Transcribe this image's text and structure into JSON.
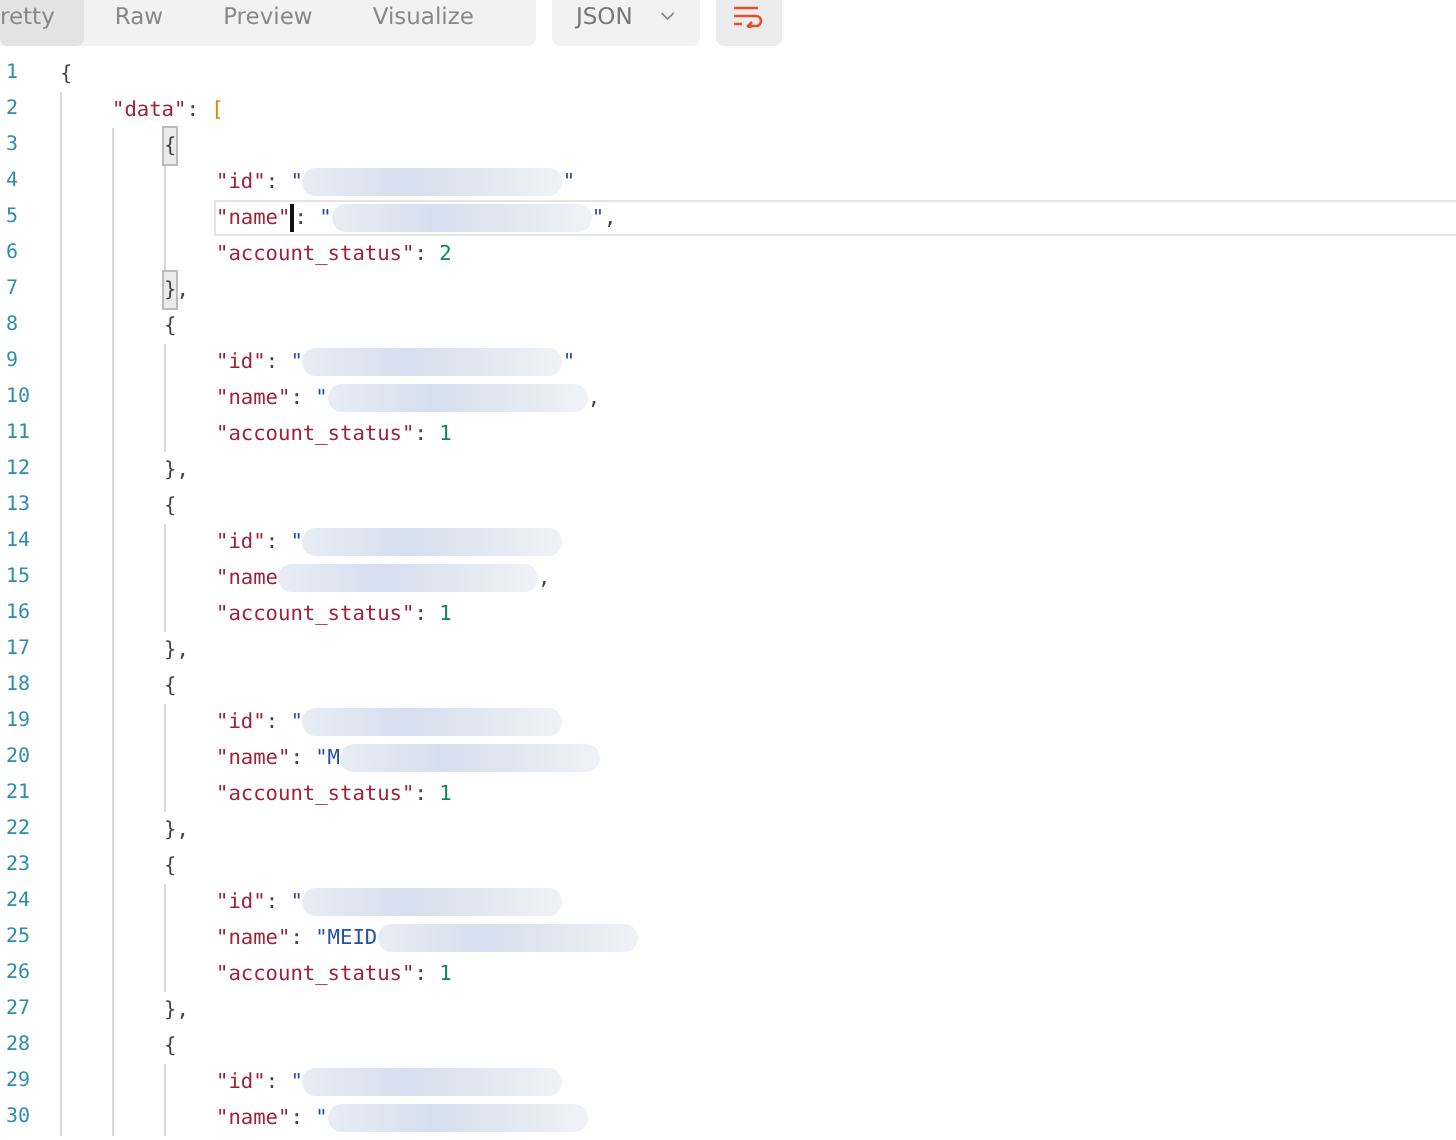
{
  "view_tabs": [
    {
      "label": "retty",
      "selected": true
    },
    {
      "label": "Raw",
      "selected": false
    },
    {
      "label": "Preview",
      "selected": false
    },
    {
      "label": "Visualize",
      "selected": false
    }
  ],
  "format_dropdown": {
    "value": "JSON"
  },
  "wrap_button": {
    "on": true
  },
  "code_lines": [
    {
      "number": "1",
      "selected": false,
      "bracket_match": false,
      "tokens": [
        {
          "kind": "punct",
          "text": "{"
        }
      ],
      "children": [
        {
          "number": "2",
          "selected": false,
          "bracket_match": false,
          "tokens": [
            {
              "kind": "key",
              "text": "\"data\""
            },
            {
              "kind": "punct",
              "text": ": "
            },
            {
              "kind": "bracket",
              "text": "["
            }
          ],
          "children": [
            {
              "number": "3",
              "selected": false,
              "bracket_match": true,
              "tokens": [
                {
                  "kind": "punct",
                  "text": "{"
                }
              ],
              "children": [
                {
                  "number": "4",
                  "selected": false,
                  "bracket_match": false,
                  "tokens": [
                    {
                      "kind": "key",
                      "text": "\"id\""
                    },
                    {
                      "kind": "punct",
                      "text": ": "
                    },
                    {
                      "kind": "string",
                      "text": "\""
                    },
                    {
                      "kind": "redacted"
                    },
                    {
                      "kind": "string",
                      "text": "\""
                    }
                  ]
                },
                {
                  "number": "5",
                  "selected": true,
                  "bracket_match": false,
                  "tokens": [
                    {
                      "kind": "key",
                      "text": "\"name\""
                    },
                    {
                      "kind": "punct",
                      "text": ": "
                    },
                    {
                      "kind": "string",
                      "text": "\""
                    },
                    {
                      "kind": "redacted"
                    },
                    {
                      "kind": "string",
                      "text": "\""
                    },
                    {
                      "kind": "punct",
                      "text": ","
                    }
                  ]
                },
                {
                  "number": "6",
                  "selected": false,
                  "bracket_match": false,
                  "tokens": [
                    {
                      "kind": "key",
                      "text": "\"account_status\""
                    },
                    {
                      "kind": "punct",
                      "text": ": "
                    },
                    {
                      "kind": "number",
                      "text": "2"
                    }
                  ]
                }
              ]
            },
            {
              "number": "7",
              "selected": false,
              "bracket_match": true,
              "tokens": [
                {
                  "kind": "punct",
                  "text": "}"
                },
                {
                  "kind": "punct",
                  "text": ","
                }
              ]
            },
            {
              "number": "8",
              "selected": false,
              "bracket_match": false,
              "tokens": [
                {
                  "kind": "punct",
                  "text": "{"
                }
              ],
              "children": [
                {
                  "number": "9",
                  "selected": false,
                  "bracket_match": false,
                  "tokens": [
                    {
                      "kind": "key",
                      "text": "\"id\""
                    },
                    {
                      "kind": "punct",
                      "text": ": "
                    },
                    {
                      "kind": "string",
                      "text": "\""
                    },
                    {
                      "kind": "redacted"
                    },
                    {
                      "kind": "string",
                      "text": "\""
                    }
                  ]
                },
                {
                  "number": "10",
                  "selected": false,
                  "bracket_match": false,
                  "tokens": [
                    {
                      "kind": "key",
                      "text": "\"name\""
                    },
                    {
                      "kind": "punct",
                      "text": ": "
                    },
                    {
                      "kind": "string",
                      "text": "\""
                    },
                    {
                      "kind": "redacted"
                    },
                    {
                      "kind": "punct",
                      "text": ","
                    }
                  ]
                },
                {
                  "number": "11",
                  "selected": false,
                  "bracket_match": false,
                  "tokens": [
                    {
                      "kind": "key",
                      "text": "\"account_status\""
                    },
                    {
                      "kind": "punct",
                      "text": ": "
                    },
                    {
                      "kind": "number",
                      "text": "1"
                    }
                  ]
                }
              ]
            },
            {
              "number": "12",
              "selected": false,
              "bracket_match": false,
              "tokens": [
                {
                  "kind": "punct",
                  "text": "},"
                }
              ]
            },
            {
              "number": "13",
              "selected": false,
              "bracket_match": false,
              "tokens": [
                {
                  "kind": "punct",
                  "text": "{"
                }
              ],
              "children": [
                {
                  "number": "14",
                  "selected": false,
                  "bracket_match": false,
                  "tokens": [
                    {
                      "kind": "key",
                      "text": "\"id\""
                    },
                    {
                      "kind": "punct",
                      "text": ": "
                    },
                    {
                      "kind": "string",
                      "text": "\""
                    },
                    {
                      "kind": "redacted"
                    }
                  ]
                },
                {
                  "number": "15",
                  "selected": false,
                  "bracket_match": false,
                  "tokens": [
                    {
                      "kind": "key",
                      "text": "\"name"
                    },
                    {
                      "kind": "redacted"
                    },
                    {
                      "kind": "punct",
                      "text": ","
                    }
                  ]
                },
                {
                  "number": "16",
                  "selected": false,
                  "bracket_match": false,
                  "tokens": [
                    {
                      "kind": "key",
                      "text": "\"account_status\""
                    },
                    {
                      "kind": "punct",
                      "text": ": "
                    },
                    {
                      "kind": "number",
                      "text": "1"
                    }
                  ]
                }
              ]
            },
            {
              "number": "17",
              "selected": false,
              "bracket_match": false,
              "tokens": [
                {
                  "kind": "punct",
                  "text": "},"
                }
              ]
            },
            {
              "number": "18",
              "selected": false,
              "bracket_match": false,
              "tokens": [
                {
                  "kind": "punct",
                  "text": "{"
                }
              ],
              "children": [
                {
                  "number": "19",
                  "selected": false,
                  "bracket_match": false,
                  "tokens": [
                    {
                      "kind": "key",
                      "text": "\"id\""
                    },
                    {
                      "kind": "punct",
                      "text": ": "
                    },
                    {
                      "kind": "string",
                      "text": "\""
                    },
                    {
                      "kind": "redacted"
                    }
                  ]
                },
                {
                  "number": "20",
                  "selected": false,
                  "bracket_match": false,
                  "tokens": [
                    {
                      "kind": "key",
                      "text": "\"name\""
                    },
                    {
                      "kind": "punct",
                      "text": ": "
                    },
                    {
                      "kind": "string",
                      "text": "\"M"
                    },
                    {
                      "kind": "redacted"
                    }
                  ]
                },
                {
                  "number": "21",
                  "selected": false,
                  "bracket_match": false,
                  "tokens": [
                    {
                      "kind": "key",
                      "text": "\"account_status\""
                    },
                    {
                      "kind": "punct",
                      "text": ": "
                    },
                    {
                      "kind": "number",
                      "text": "1"
                    }
                  ]
                }
              ]
            },
            {
              "number": "22",
              "selected": false,
              "bracket_match": false,
              "tokens": [
                {
                  "kind": "punct",
                  "text": "},"
                }
              ]
            },
            {
              "number": "23",
              "selected": false,
              "bracket_match": false,
              "tokens": [
                {
                  "kind": "punct",
                  "text": "{"
                }
              ],
              "children": [
                {
                  "number": "24",
                  "selected": false,
                  "bracket_match": false,
                  "tokens": [
                    {
                      "kind": "key",
                      "text": "\"id\""
                    },
                    {
                      "kind": "punct",
                      "text": ": "
                    },
                    {
                      "kind": "string",
                      "text": "\""
                    },
                    {
                      "kind": "redacted"
                    }
                  ]
                },
                {
                  "number": "25",
                  "selected": false,
                  "bracket_match": false,
                  "tokens": [
                    {
                      "kind": "key",
                      "text": "\"name\""
                    },
                    {
                      "kind": "punct",
                      "text": ": "
                    },
                    {
                      "kind": "string",
                      "text": "\"MEID"
                    },
                    {
                      "kind": "redacted"
                    }
                  ]
                },
                {
                  "number": "26",
                  "selected": false,
                  "bracket_match": false,
                  "tokens": [
                    {
                      "kind": "key",
                      "text": "\"account_status\""
                    },
                    {
                      "kind": "punct",
                      "text": ": "
                    },
                    {
                      "kind": "number",
                      "text": "1"
                    }
                  ]
                }
              ]
            },
            {
              "number": "27",
              "selected": false,
              "bracket_match": false,
              "tokens": [
                {
                  "kind": "punct",
                  "text": "},"
                }
              ]
            },
            {
              "number": "28",
              "selected": false,
              "bracket_match": false,
              "tokens": [
                {
                  "kind": "punct",
                  "text": "{"
                }
              ],
              "children": [
                {
                  "number": "29",
                  "selected": false,
                  "bracket_match": false,
                  "tokens": [
                    {
                      "kind": "key",
                      "text": "\"id\""
                    },
                    {
                      "kind": "punct",
                      "text": ": "
                    },
                    {
                      "kind": "string",
                      "text": "\""
                    },
                    {
                      "kind": "redacted"
                    }
                  ]
                },
                {
                  "number": "30",
                  "selected": false,
                  "bracket_match": false,
                  "tokens": [
                    {
                      "kind": "key",
                      "text": "\"name\""
                    },
                    {
                      "kind": "punct",
                      "text": ": "
                    },
                    {
                      "kind": "string",
                      "text": "\""
                    },
                    {
                      "kind": "redacted"
                    }
                  ]
                }
              ]
            }
          ]
        }
      ]
    }
  ]
}
